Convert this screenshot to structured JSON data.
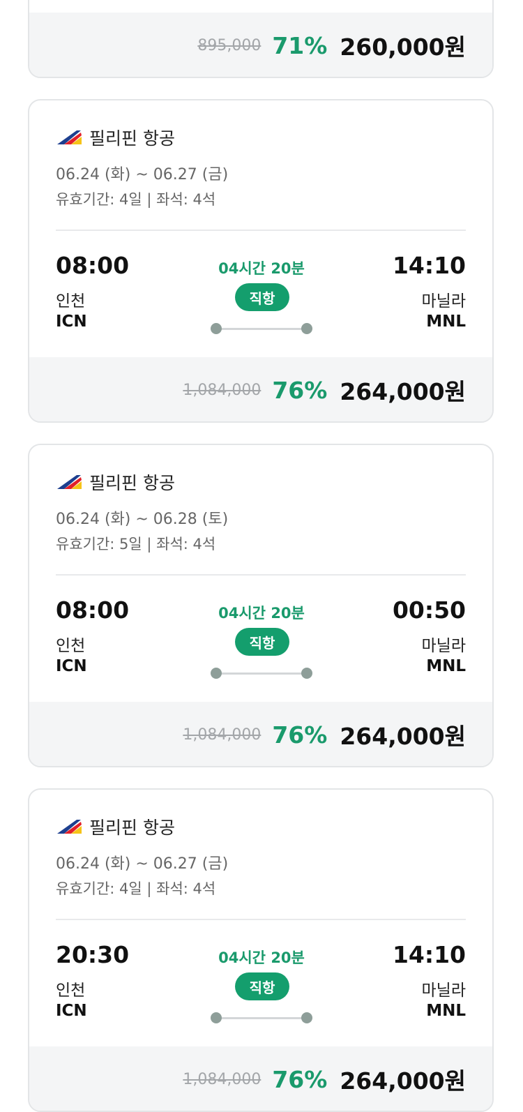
{
  "colors": {
    "accent_green": "#149e6d",
    "discount_green": "#1a9a6c",
    "price_bar_bg": "#f4f5f6",
    "route_dot": "#8e9e99"
  },
  "cards": [
    {
      "partial": true,
      "price": {
        "original": "895,000",
        "discount": "71%",
        "final": "260,000원"
      }
    },
    {
      "airline": {
        "name": "필리핀 항공",
        "logo_icon": "philippine-airlines-logo"
      },
      "dates": "06.24 (화) ~ 06.27 (금)",
      "validity": "유효기간: 4일 | 좌석: 4석",
      "departure": {
        "time": "08:00",
        "city": "인천",
        "code": "ICN"
      },
      "arrival": {
        "time": "14:10",
        "city": "마닐라",
        "code": "MNL"
      },
      "duration": "04시간 20분",
      "direct_label": "직항",
      "price": {
        "original": "1,084,000",
        "discount": "76%",
        "final": "264,000원"
      }
    },
    {
      "airline": {
        "name": "필리핀 항공",
        "logo_icon": "philippine-airlines-logo"
      },
      "dates": "06.24 (화) ~ 06.28 (토)",
      "validity": "유효기간: 5일 | 좌석: 4석",
      "departure": {
        "time": "08:00",
        "city": "인천",
        "code": "ICN"
      },
      "arrival": {
        "time": "00:50",
        "city": "마닐라",
        "code": "MNL"
      },
      "duration": "04시간 20분",
      "direct_label": "직항",
      "price": {
        "original": "1,084,000",
        "discount": "76%",
        "final": "264,000원"
      }
    },
    {
      "airline": {
        "name": "필리핀 항공",
        "logo_icon": "philippine-airlines-logo"
      },
      "dates": "06.24 (화) ~ 06.27 (금)",
      "validity": "유효기간: 4일 | 좌석: 4석",
      "departure": {
        "time": "20:30",
        "city": "인천",
        "code": "ICN"
      },
      "arrival": {
        "time": "14:10",
        "city": "마닐라",
        "code": "MNL"
      },
      "duration": "04시간 20분",
      "direct_label": "직항",
      "price": {
        "original": "1,084,000",
        "discount": "76%",
        "final": "264,000원"
      }
    }
  ]
}
